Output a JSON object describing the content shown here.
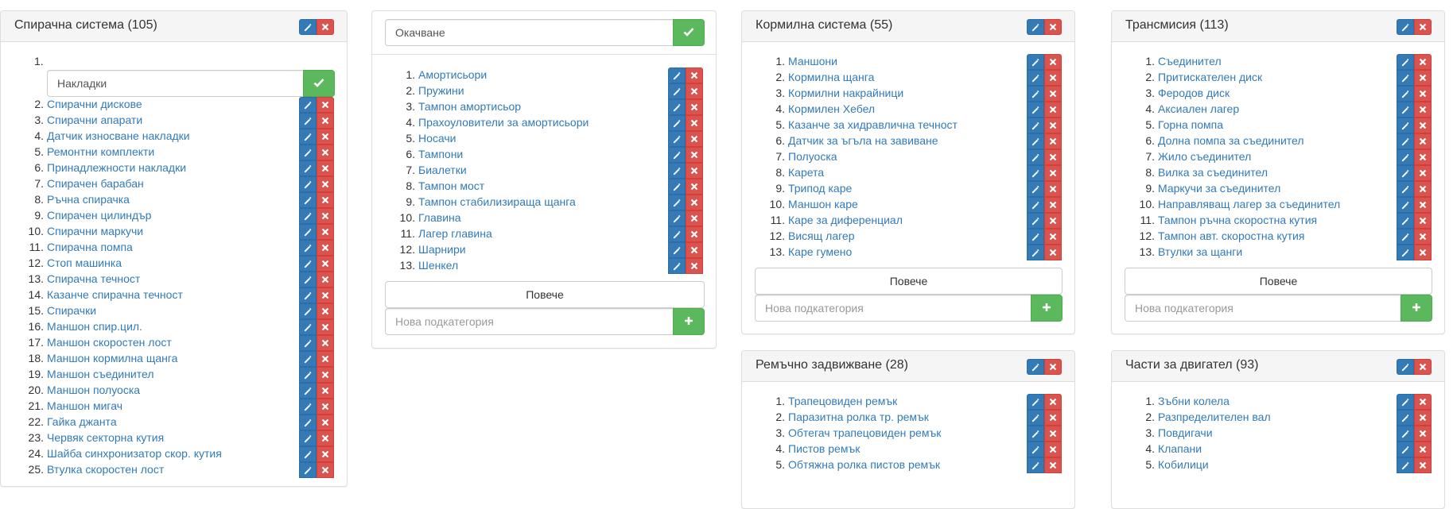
{
  "colors": {
    "edit": "#337ab7",
    "delete": "#d9534f",
    "confirm": "#5cb85c",
    "link": "#337ab7"
  },
  "icons": {
    "edit": "pencil-icon",
    "delete": "times-icon",
    "confirm": "check-icon",
    "add": "plus-icon"
  },
  "panels": [
    {
      "title": "Спирачна система (105)",
      "edit_value": "Накладки",
      "items": [
        "Спирачни дискове",
        "Спирачни апарати",
        "Датчик износване накладки",
        "Ремонтни комплекти",
        "Принадлежности накладки",
        "Спирачен барабан",
        "Ръчна спирачка",
        "Спирачен цилиндър",
        "Спирачни маркучи",
        "Спирачна помпа",
        "Стоп машинка",
        "Спирачна течност",
        "Казанче спирачна течност",
        "Спирачки",
        "Маншон спир.цил.",
        "Маншон скоростен лост",
        "Маншон кормилна щанга",
        "Маншон съединител",
        "Маншон полуоска",
        "Маншон мигач",
        "Гайка джанта",
        "Червяк секторна кутия",
        "Шайба синхронизатор скор. кутия",
        "Втулка скоростен лост"
      ]
    },
    {
      "title": "Окачване",
      "items": [
        "Амортисьори",
        "Пружини",
        "Тампон амортисьор",
        "Прахоуловители за амортисьори",
        "Носачи",
        "Тампони",
        "Биалетки",
        "Тампон мост",
        "Тампон стабилизираща щанга",
        "Главина",
        "Лагер главина",
        "Шарнири",
        "Шенкел"
      ],
      "more_label": "Повече",
      "new_placeholder": "Нова подкатегория"
    },
    {
      "title": "Кормилна система (55)",
      "items": [
        "Маншони",
        "Кормилна щанга",
        "Кормилни накрайници",
        "Кормилен Хебел",
        "Казанче за хидравлична течност",
        "Датчик за ъгъла на завиване",
        "Полуоска",
        "Карета",
        "Трипод каре",
        "Маншон каре",
        "Каре за диференциал",
        "Висящ лагер",
        "Каре гумено"
      ],
      "more_label": "Повече",
      "new_placeholder": "Нова подкатегория"
    },
    {
      "title": "Трансмисия (113)",
      "items": [
        "Съединител",
        "Притискателен диск",
        "Феродов диск",
        "Аксиален лагер",
        "Горна помпа",
        "Долна помпа за съединител",
        "Жило съединител",
        "Вилка за съединител",
        "Маркучи за съединител",
        "Направляващ лагер за съединител",
        "Тампон ръчна скоростна кутия",
        "Тампон авт. скоростна кутия",
        "Втулки за щанги"
      ],
      "more_label": "Повече",
      "new_placeholder": "Нова подкатегория"
    },
    {
      "title": "Ремъчно задвижване (28)",
      "items": [
        "Трапецовиден ремък",
        "Паразитна ролка тр. ремък",
        "Обтегач трапецовиден ремък",
        "Пистов ремък",
        "Обтяжна ролка пистов ремък"
      ]
    },
    {
      "title": "Части за двигател (93)",
      "items": [
        "Зъбни колела",
        "Разпределителен вал",
        "Повдигачи",
        "Клапани",
        "Кобилици"
      ]
    }
  ]
}
